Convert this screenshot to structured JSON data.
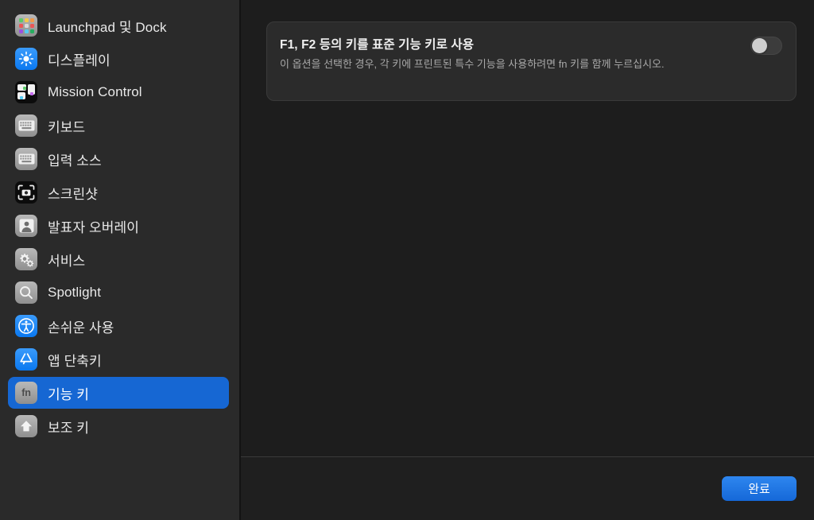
{
  "window": {
    "background": "#1d1d1d",
    "accent": "#1667d3"
  },
  "sidebar": {
    "background": "#2a2a2a",
    "selected_index": 11,
    "items": [
      {
        "label": "Launchpad 및 Dock",
        "icon": "launchpad-icon"
      },
      {
        "label": "디스플레이",
        "icon": "display-icon"
      },
      {
        "label": "Mission Control",
        "icon": "mission-control-icon"
      },
      {
        "label": "키보드",
        "icon": "keyboard-icon"
      },
      {
        "label": "입력 소스",
        "icon": "input-sources-icon"
      },
      {
        "label": "스크린샷",
        "icon": "screenshot-icon"
      },
      {
        "label": "발표자 오버레이",
        "icon": "presenter-overlay-icon"
      },
      {
        "label": "서비스",
        "icon": "services-gears-icon"
      },
      {
        "label": "Spotlight",
        "icon": "spotlight-search-icon"
      },
      {
        "label": "손쉬운 사용",
        "icon": "accessibility-icon"
      },
      {
        "label": "앱 단축키",
        "icon": "app-shortcuts-icon"
      },
      {
        "label": "기능 키",
        "icon": "function-key-fn-icon"
      },
      {
        "label": "보조 키",
        "icon": "modifier-key-shift-icon"
      }
    ]
  },
  "main": {
    "card": {
      "title": "F1, F2 등의 키를 표준 기능 키로 사용",
      "description": "이 옵션을 선택한 경우, 각 키에 프린트된 특수 기능을 사용하려면 fn 키를 함께 누르십시오.",
      "toggle": {
        "name": "standard-function-keys-toggle",
        "state": "off"
      }
    }
  },
  "footer": {
    "done_label": "완료"
  },
  "icons": {
    "fn_text": "fn",
    "launchpad_colors": [
      "#5dc96a",
      "#f2c94c",
      "#f2994a",
      "#eb5757",
      "#bdbdbd",
      "#eb5757",
      "#9b51e0",
      "#56ccf2",
      "#27ae60"
    ]
  }
}
